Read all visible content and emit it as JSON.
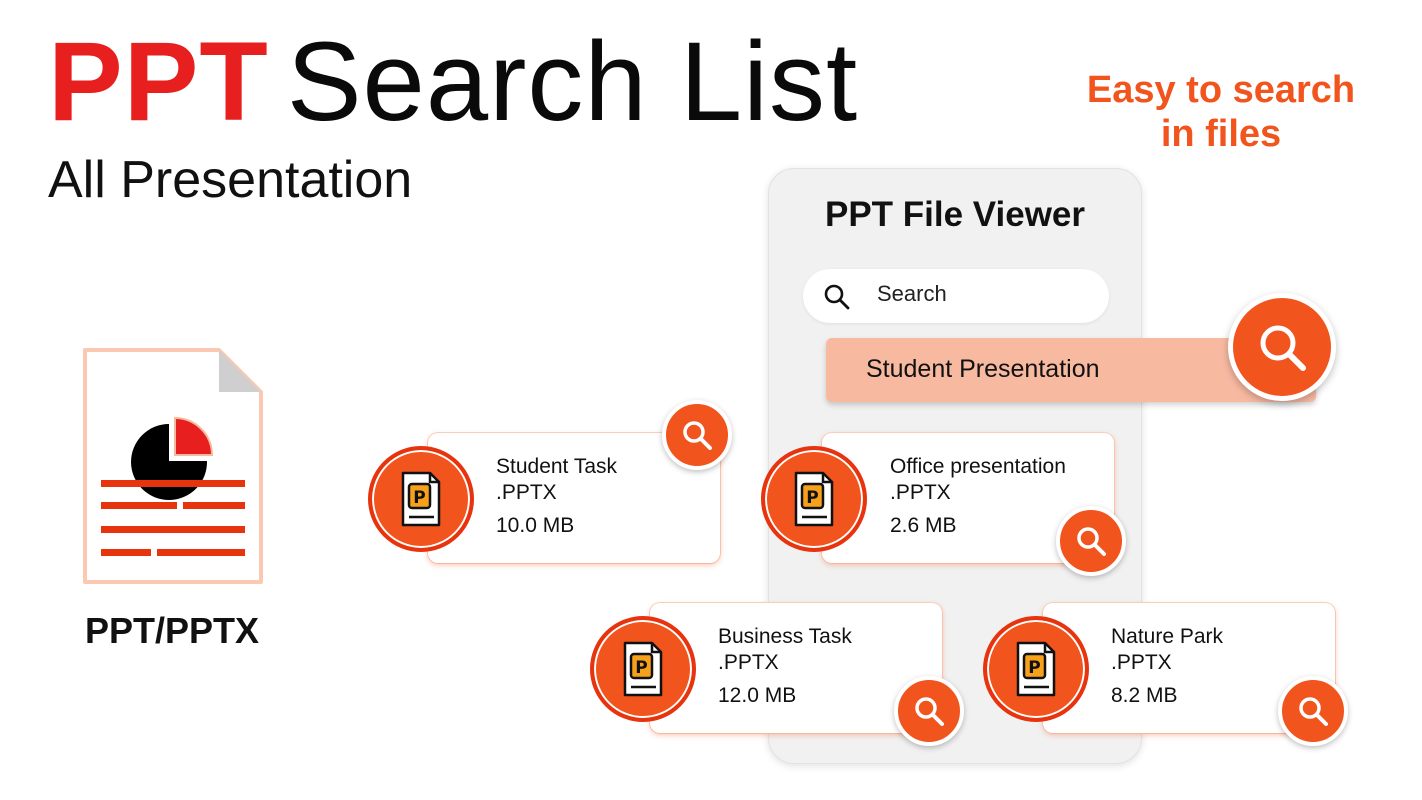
{
  "header": {
    "brand": "PPT",
    "title_rest": "Search List",
    "subtitle": "All Presentation"
  },
  "tagline": {
    "line1": "Easy to search",
    "line2": "in files"
  },
  "document": {
    "label": "PPT/PPTX",
    "icon": "presentation-document-icon"
  },
  "phone": {
    "title": "PPT File Viewer",
    "search_placeholder": "Search",
    "query": "Student Presentation"
  },
  "files": [
    {
      "name": "Student Task",
      "ext": ".PPTX",
      "size": "10.0 MB"
    },
    {
      "name": "Office presentation",
      "ext": ".PPTX",
      "size": "2.6 MB"
    },
    {
      "name": "Business Task",
      "ext": ".PPTX",
      "size": "12.0 MB"
    },
    {
      "name": "Nature Park",
      "ext": ".PPTX",
      "size": "8.2 MB"
    }
  ],
  "colors": {
    "brand_red": "#e81f1f",
    "accent_orange": "#f1541c",
    "pill_salmon": "#f8b9a1"
  }
}
